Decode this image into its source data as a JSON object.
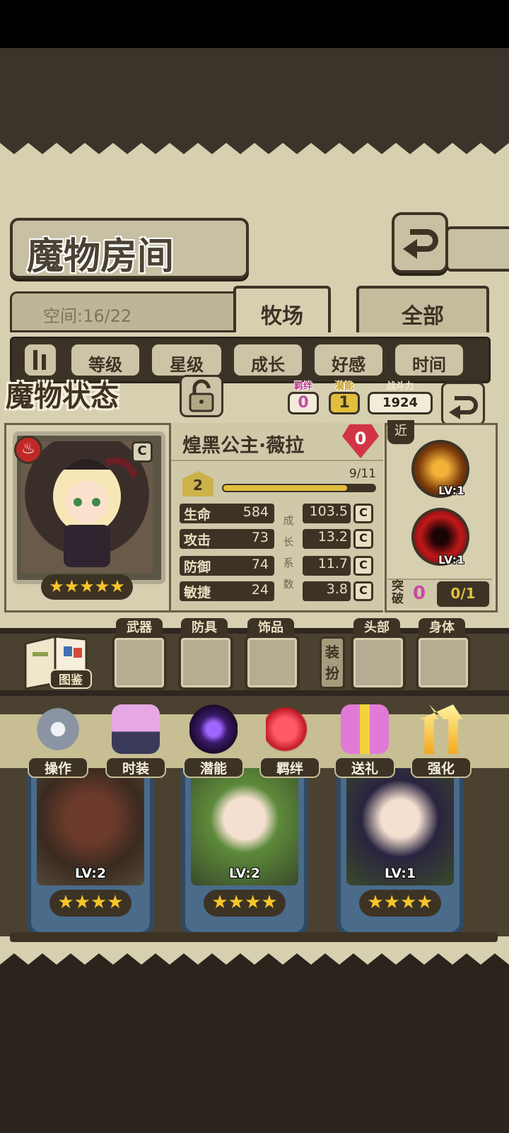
{
  "header": {
    "title": "魔物房间"
  },
  "storage": {
    "space": "空间:16/22"
  },
  "tabs": [
    {
      "label": "牧场",
      "active": true
    },
    {
      "label": "全部",
      "active": false
    }
  ],
  "sort_buttons": [
    "等级",
    "星级",
    "成长",
    "好感",
    "时间"
  ],
  "status": {
    "title": "魔物状态",
    "bond_label": "羁绊",
    "bond_value": "0",
    "potential_label": "潜能",
    "potential_value": "1",
    "power_label": "战斗力",
    "power_value": "1924"
  },
  "monster": {
    "name": "煌黑公主·薇拉",
    "gem_value": "0",
    "rank": "C",
    "element_icon": "fire-icon",
    "stars": "★★★★★",
    "level": "2",
    "exp_text": "9/11",
    "exp_fraction": 0.82,
    "stats": [
      {
        "label": "生命",
        "value": "584",
        "growth": "103.5",
        "grade": "C"
      },
      {
        "label": "攻击",
        "value": "73",
        "growth": "13.2",
        "grade": "C"
      },
      {
        "label": "防御",
        "value": "74",
        "growth": "11.7",
        "grade": "C"
      },
      {
        "label": "敏捷",
        "value": "24",
        "growth": "3.8",
        "grade": "C"
      }
    ],
    "growth_chars": [
      "成",
      "长",
      "系",
      "数"
    ],
    "range_tag": "近",
    "skills": [
      {
        "icon": "slash-skill-icon",
        "level": "LV:1"
      },
      {
        "icon": "dark-orb-skill-icon",
        "level": "LV:1"
      }
    ],
    "breakthrough_label": "突破",
    "breakthrough_value": "0",
    "breakthrough_count": "0/1"
  },
  "equipment": {
    "codex_label": "图鉴",
    "slots": [
      "武器",
      "防具",
      "饰品",
      "头部",
      "身体"
    ],
    "dress_label": "装扮"
  },
  "actions": [
    {
      "label": "操作",
      "icon": "gear-icon"
    },
    {
      "label": "时装",
      "icon": "outfit-icon"
    },
    {
      "label": "潜能",
      "icon": "demon-icon"
    },
    {
      "label": "羁绊",
      "icon": "hearts-icon"
    },
    {
      "label": "送礼",
      "icon": "gift-icon"
    },
    {
      "label": "强化",
      "icon": "upgrade-arrows-icon"
    }
  ],
  "monster_list": [
    {
      "level": "LV:2",
      "stars": "★★★★"
    },
    {
      "level": "LV:2",
      "stars": "★★★★"
    },
    {
      "level": "LV:1",
      "stars": "★★★★"
    }
  ]
}
